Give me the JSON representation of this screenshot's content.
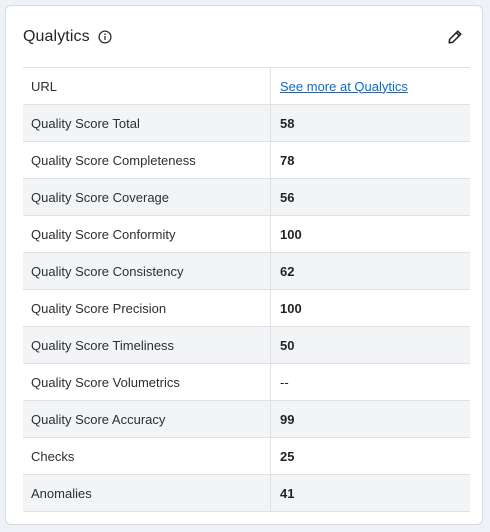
{
  "card": {
    "title": "Qualytics",
    "info_icon": "info-circle-icon",
    "edit_icon": "pencil-icon"
  },
  "table": {
    "rows": [
      {
        "label": "URL",
        "value": "See more at Qualytics",
        "is_link": true
      },
      {
        "label": "Quality Score Total",
        "value": "58"
      },
      {
        "label": "Quality Score Completeness",
        "value": "78"
      },
      {
        "label": "Quality Score Coverage",
        "value": "56"
      },
      {
        "label": "Quality Score Conformity",
        "value": "100"
      },
      {
        "label": "Quality Score Consistency",
        "value": "62"
      },
      {
        "label": "Quality Score Precision",
        "value": "100"
      },
      {
        "label": "Quality Score Timeliness",
        "value": "50"
      },
      {
        "label": "Quality Score Volumetrics",
        "value": "--"
      },
      {
        "label": "Quality Score Accuracy",
        "value": "99"
      },
      {
        "label": "Checks",
        "value": "25"
      },
      {
        "label": "Anomalies",
        "value": "41"
      }
    ]
  },
  "colors": {
    "link": "#0b6bcb",
    "row_alt": "#f3f4f6",
    "border": "#dde1e6"
  }
}
